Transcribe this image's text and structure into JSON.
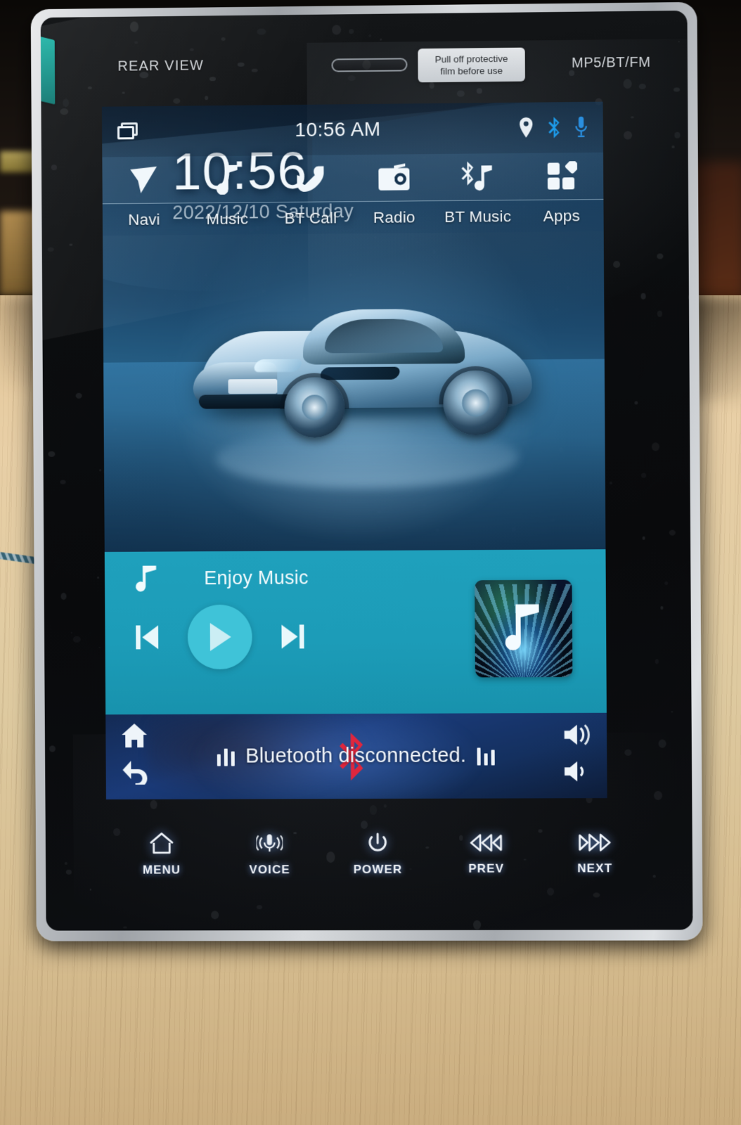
{
  "device": {
    "bezel_labels": {
      "left": "REAR VIEW",
      "right": "MP5/BT/FM"
    },
    "sticker": {
      "line1": "Pull off protective",
      "line2": "film before use"
    }
  },
  "statusbar": {
    "recent_apps_icon": "recent-apps-icon",
    "clock": "10:56 AM",
    "icons": [
      {
        "name": "location-pin-icon",
        "color": "#e8eef3"
      },
      {
        "name": "bluetooth-icon",
        "color": "#1d9ae8"
      },
      {
        "name": "microphone-icon",
        "color": "#2a8fe0"
      }
    ]
  },
  "tabs": [
    {
      "label": "Navi",
      "icon": "navigation-arrow-icon"
    },
    {
      "label": "Music",
      "icon": "music-note-icon"
    },
    {
      "label": "BT Call",
      "icon": "phone-handset-icon"
    },
    {
      "label": "Radio",
      "icon": "radio-icon"
    },
    {
      "label": "BT Music",
      "icon": "bluetooth-music-icon"
    },
    {
      "label": "Apps",
      "icon": "apps-grid-icon"
    }
  ],
  "clock_widget": {
    "time": "10:56",
    "date": "2022/12/10  Saturday"
  },
  "wallpaper": {
    "description": "silver supercar on wet blue-lit floor"
  },
  "music_player": {
    "source_icon": "music-note-icon",
    "title": "Enjoy Music",
    "prev_icon": "skip-previous-icon",
    "play_icon": "play-icon",
    "next_icon": "skip-next-icon",
    "album_art_icon": "music-note-album-art",
    "panel_color": "#1c9cb8",
    "play_button_color": "#3fc3d8"
  },
  "bottom_bar": {
    "home_icon": "home-icon",
    "back_icon": "back-arrow-icon",
    "message": "Bluetooth disconnected.",
    "bluetooth_icon_color": "#e8253a",
    "volume_up_icon": "volume-up-icon",
    "volume_down_icon": "volume-down-icon"
  },
  "hard_keys": [
    {
      "label": "MENU",
      "icon": "home-outline-icon"
    },
    {
      "label": "VOICE",
      "icon": "voice-microphone-icon"
    },
    {
      "label": "POWER",
      "icon": "power-icon"
    },
    {
      "label": "PREV",
      "icon": "rewind-icon"
    },
    {
      "label": "NEXT",
      "icon": "fast-forward-icon"
    }
  ]
}
